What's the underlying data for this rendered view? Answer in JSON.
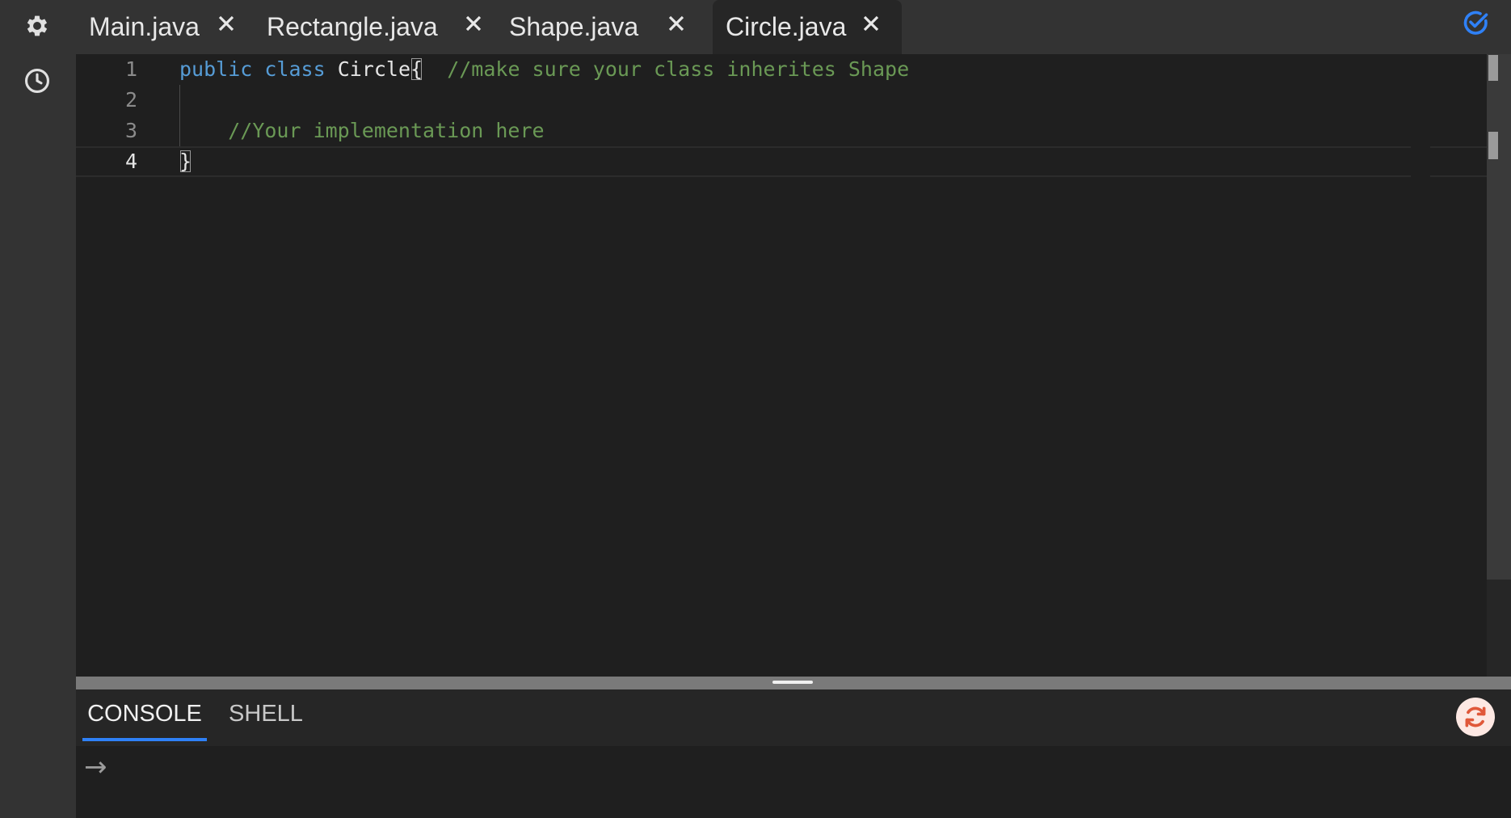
{
  "tabs": [
    {
      "label": "Main.java",
      "active": false
    },
    {
      "label": "Rectangle.java",
      "active": false
    },
    {
      "label": "Shape.java",
      "active": false
    },
    {
      "label": "Circle.java",
      "active": true
    }
  ],
  "editor": {
    "lines": [
      {
        "number": "1"
      },
      {
        "number": "2"
      },
      {
        "number": "3"
      },
      {
        "number": "4"
      }
    ],
    "tokens": {
      "kw_public": "public",
      "kw_class": "class",
      "class_name": "Circle",
      "open_brace": "{",
      "comment_1": "//make sure your class inherites Shape",
      "comment_2": "//Your implementation here",
      "close_brace": "}"
    }
  },
  "console": {
    "tabs": [
      {
        "label": "CONSOLE",
        "active": true
      },
      {
        "label": "SHELL",
        "active": false
      }
    ],
    "prompt_symbol": "→"
  },
  "colors": {
    "accent": "#2f81f7",
    "keyword": "#569cd6",
    "comment": "#6a9955",
    "restart": "#e0583a"
  },
  "icons": {
    "settings": "gear-icon",
    "history": "clock-icon",
    "close": "close-icon",
    "check": "check-circle-icon",
    "restart": "restart-icon"
  }
}
